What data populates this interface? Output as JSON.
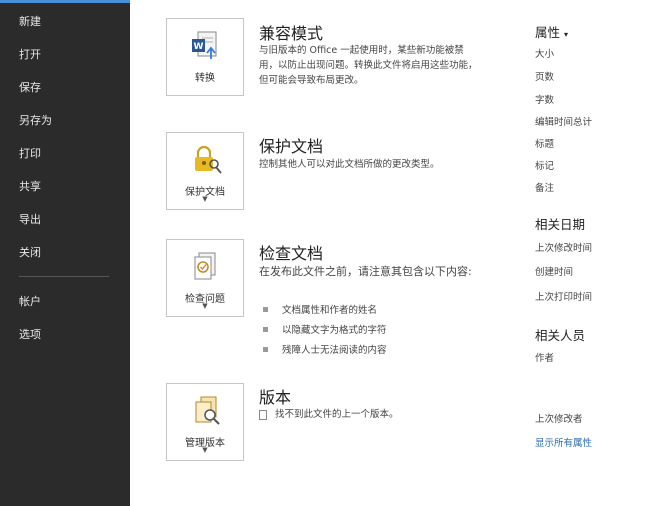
{
  "nav": {
    "items": [
      "新建",
      "打开",
      "保存",
      "另存为",
      "打印",
      "共享",
      "导出",
      "关闭"
    ],
    "bottom_items": [
      "帐户",
      "选项"
    ]
  },
  "sections": {
    "compat": {
      "tile_label": "转换",
      "title": "兼容模式",
      "desc": "与旧版本的 Office 一起使用时，某些新功能被禁用，以防止出现问题。转换此文件将启用这些功能，但可能会导致布局更改。"
    },
    "protect": {
      "tile_label": "保护文档",
      "title": "保护文档",
      "desc": "控制其他人可以对此文档所做的更改类型。"
    },
    "inspect": {
      "tile_label": "检查问题",
      "title": "检查文档",
      "desc": "在发布此文件之前，请注意其包含以下内容:",
      "bullets": [
        "文档属性和作者的姓名",
        "以隐藏文字为格式的字符",
        "残障人士无法阅读的内容"
      ]
    },
    "versions": {
      "tile_label": "管理版本",
      "title": "版本",
      "note": "找不到此文件的上一个版本。"
    }
  },
  "properties": {
    "header": "属性",
    "items": [
      "大小",
      "页数",
      "字数",
      "编辑时间总计",
      "标题",
      "标记",
      "备注"
    ],
    "dates_header": "相关日期",
    "dates": [
      "上次修改时间",
      "创建时间",
      "上次打印时间"
    ],
    "people_header": "相关人员",
    "people": [
      "作者",
      "上次修改者"
    ],
    "show_all": "显示所有属性"
  },
  "colors": {
    "nav_bg": "#2b2b2b",
    "accent": "#4a90d9",
    "link": "#2b6cb0",
    "tile_border": "#c6c6c6"
  }
}
